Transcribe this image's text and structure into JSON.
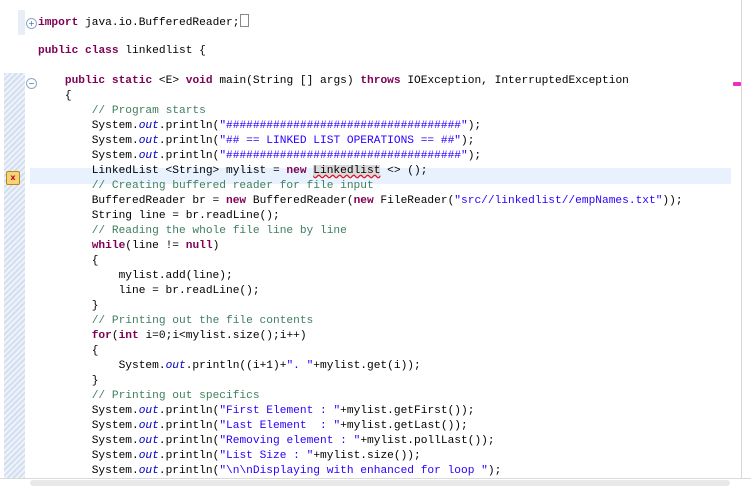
{
  "editor": {
    "fold_expand_glyph": "+",
    "fold_collapse_glyph": "−",
    "error_glyph": "x",
    "lines": [
      {
        "parts": [
          {
            "t": "import",
            "c": "kw"
          },
          {
            "t": " java.io.BufferedReader;"
          },
          {
            "box": true
          }
        ]
      },
      {
        "parts": []
      },
      {
        "parts": [
          {
            "t": "public",
            "c": "kw"
          },
          {
            "t": " "
          },
          {
            "t": "class",
            "c": "kw"
          },
          {
            "t": " linkedlist {"
          }
        ]
      },
      {
        "parts": []
      },
      {
        "parts": [
          {
            "t": "    "
          },
          {
            "t": "public",
            "c": "kw"
          },
          {
            "t": " "
          },
          {
            "t": "static",
            "c": "kw"
          },
          {
            "t": " <E> "
          },
          {
            "t": "void",
            "c": "kw"
          },
          {
            "t": " main(String [] args) "
          },
          {
            "t": "throws",
            "c": "kw"
          },
          {
            "t": " IOException, InterruptedException"
          }
        ]
      },
      {
        "parts": [
          {
            "t": "    {"
          }
        ]
      },
      {
        "parts": [
          {
            "t": "        "
          },
          {
            "t": "// Program starts",
            "c": "cm"
          }
        ]
      },
      {
        "parts": [
          {
            "t": "        System."
          },
          {
            "t": "out",
            "c": "fi"
          },
          {
            "t": ".println("
          },
          {
            "t": "\"###################################\"",
            "c": "st"
          },
          {
            "t": ");"
          }
        ]
      },
      {
        "parts": [
          {
            "t": "        System."
          },
          {
            "t": "out",
            "c": "fi"
          },
          {
            "t": ".println("
          },
          {
            "t": "\"## == LINKED LIST OPERATIONS == ##\"",
            "c": "st"
          },
          {
            "t": ");"
          }
        ]
      },
      {
        "parts": [
          {
            "t": "        System."
          },
          {
            "t": "out",
            "c": "fi"
          },
          {
            "t": ".println("
          },
          {
            "t": "\"###################################\"",
            "c": "st"
          },
          {
            "t": ");"
          }
        ]
      },
      {
        "parts": [
          {
            "t": "        LinkedList <String> mylist = "
          },
          {
            "t": "new",
            "c": "kw"
          },
          {
            "t": " "
          },
          {
            "t": "Linkedlist",
            "c": "err"
          },
          {
            "t": " <> ();"
          }
        ]
      },
      {
        "parts": [
          {
            "t": "        "
          },
          {
            "t": "// Creating buffered reader for file input",
            "c": "cm"
          }
        ]
      },
      {
        "parts": [
          {
            "t": "        BufferedReader br = "
          },
          {
            "t": "new",
            "c": "kw"
          },
          {
            "t": " BufferedReader("
          },
          {
            "t": "new",
            "c": "kw"
          },
          {
            "t": " FileReader("
          },
          {
            "t": "\"src//linkedlist//empNames.txt\"",
            "c": "st"
          },
          {
            "t": "));"
          }
        ]
      },
      {
        "parts": [
          {
            "t": "        String line = br.readLine();"
          }
        ]
      },
      {
        "parts": [
          {
            "t": "        "
          },
          {
            "t": "// Reading the whole file line by line",
            "c": "cm"
          }
        ]
      },
      {
        "parts": [
          {
            "t": "        "
          },
          {
            "t": "while",
            "c": "kw"
          },
          {
            "t": "(line != "
          },
          {
            "t": "null",
            "c": "kw"
          },
          {
            "t": ")"
          }
        ]
      },
      {
        "parts": [
          {
            "t": "        {"
          }
        ]
      },
      {
        "parts": [
          {
            "t": "            mylist.add(line);"
          }
        ]
      },
      {
        "parts": [
          {
            "t": "            line = br.readLine();"
          }
        ]
      },
      {
        "parts": [
          {
            "t": "        }"
          }
        ]
      },
      {
        "parts": [
          {
            "t": "        "
          },
          {
            "t": "// Printing out the file contents",
            "c": "cm"
          }
        ]
      },
      {
        "parts": [
          {
            "t": "        "
          },
          {
            "t": "for",
            "c": "kw"
          },
          {
            "t": "("
          },
          {
            "t": "int",
            "c": "kw"
          },
          {
            "t": " i=0;i<mylist.size();i++)"
          }
        ]
      },
      {
        "parts": [
          {
            "t": "        {"
          }
        ]
      },
      {
        "parts": [
          {
            "t": "            System."
          },
          {
            "t": "out",
            "c": "fi"
          },
          {
            "t": ".println((i+1)+"
          },
          {
            "t": "\". \"",
            "c": "st"
          },
          {
            "t": "+mylist.get(i));"
          }
        ]
      },
      {
        "parts": [
          {
            "t": "        }"
          }
        ]
      },
      {
        "parts": [
          {
            "t": "        "
          },
          {
            "t": "// Printing out specifics",
            "c": "cm"
          }
        ]
      },
      {
        "parts": [
          {
            "t": "        System."
          },
          {
            "t": "out",
            "c": "fi"
          },
          {
            "t": ".println("
          },
          {
            "t": "\"First Element : \"",
            "c": "st"
          },
          {
            "t": "+mylist.getFirst());"
          }
        ]
      },
      {
        "parts": [
          {
            "t": "        System."
          },
          {
            "t": "out",
            "c": "fi"
          },
          {
            "t": ".println("
          },
          {
            "t": "\"Last Element  : \"",
            "c": "st"
          },
          {
            "t": "+mylist.getLast());"
          }
        ]
      },
      {
        "parts": [
          {
            "t": "        System."
          },
          {
            "t": "out",
            "c": "fi"
          },
          {
            "t": ".println("
          },
          {
            "t": "\"Removing element : \"",
            "c": "st"
          },
          {
            "t": "+mylist.pollLast());"
          }
        ]
      },
      {
        "parts": [
          {
            "t": "        System."
          },
          {
            "t": "out",
            "c": "fi"
          },
          {
            "t": ".println("
          },
          {
            "t": "\"List Size : \"",
            "c": "st"
          },
          {
            "t": "+mylist.size());"
          }
        ]
      },
      {
        "parts": [
          {
            "t": "        System."
          },
          {
            "t": "out",
            "c": "fi"
          },
          {
            "t": ".println("
          },
          {
            "t": "\"\\n\\nDisplaying with enhanced for loop \"",
            "c": "st"
          },
          {
            "t": ");"
          }
        ]
      }
    ]
  }
}
